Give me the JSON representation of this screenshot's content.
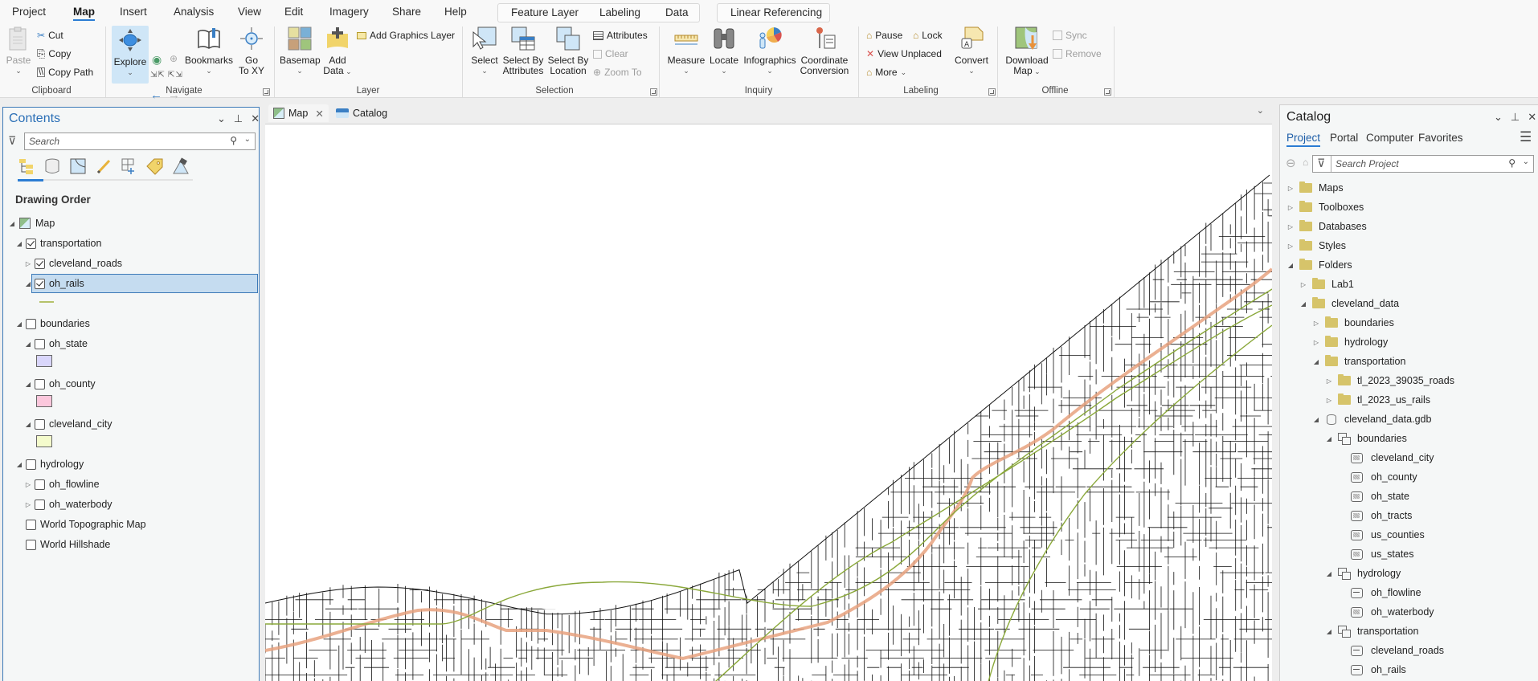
{
  "menu_tabs": [
    "Project",
    "Map",
    "Insert",
    "Analysis",
    "View",
    "Edit",
    "Imagery",
    "Share",
    "Help"
  ],
  "active_menu_tab": "Map",
  "contextual_tabs": {
    "feature_layer_group": [
      "Feature Layer",
      "Labeling",
      "Data"
    ],
    "linear_referencing": "Linear Referencing"
  },
  "ribbon": {
    "clipboard": {
      "label": "Clipboard",
      "paste": "Paste",
      "cut": "Cut",
      "copy": "Copy",
      "copy_path": "Copy Path"
    },
    "navigate": {
      "label": "Navigate",
      "explore": "Explore",
      "bookmarks": "Bookmarks",
      "go_to_xy_1": "Go",
      "go_to_xy_2": "To XY"
    },
    "layer": {
      "label": "Layer",
      "basemap": "Basemap",
      "add_data_1": "Add",
      "add_data_2": "Data",
      "add_graphics_layer": "Add Graphics Layer"
    },
    "selection": {
      "label": "Selection",
      "select": "Select",
      "select_by_attributes_1": "Select By",
      "select_by_attributes_2": "Attributes",
      "select_by_location_1": "Select By",
      "select_by_location_2": "Location",
      "attributes": "Attributes",
      "clear": "Clear",
      "zoom_to": "Zoom To"
    },
    "inquiry": {
      "label": "Inquiry",
      "measure": "Measure",
      "locate": "Locate",
      "infographics": "Infographics",
      "coordinate_conversion_1": "Coordinate",
      "coordinate_conversion_2": "Conversion"
    },
    "labeling": {
      "label": "Labeling",
      "pause": "Pause",
      "lock": "Lock",
      "view_unplaced": "View Unplaced",
      "more": "More",
      "convert": "Convert"
    },
    "offline": {
      "label": "Offline",
      "download_map_1": "Download",
      "download_map_2": "Map",
      "sync": "Sync",
      "remove": "Remove"
    }
  },
  "contents": {
    "title": "Contents",
    "search_placeholder": "Search",
    "section_title": "Drawing Order",
    "map_name": "Map",
    "layers": [
      {
        "name": "transportation",
        "checked": true,
        "expanded": true,
        "level": 1
      },
      {
        "name": "cleveland_roads",
        "checked": true,
        "expanded": false,
        "level": 2
      },
      {
        "name": "oh_rails",
        "checked": true,
        "expanded": true,
        "level": 2,
        "selected": true,
        "symbol_color": "#b5c26a"
      },
      {
        "name": "boundaries",
        "checked": false,
        "expanded": true,
        "level": 1
      },
      {
        "name": "oh_state",
        "checked": false,
        "expanded": true,
        "level": 2,
        "symbol_color": "#d9d6fb"
      },
      {
        "name": "oh_county",
        "checked": false,
        "expanded": true,
        "level": 2,
        "symbol_color": "#fbc7dc"
      },
      {
        "name": "cleveland_city",
        "checked": false,
        "expanded": true,
        "level": 2,
        "symbol_color": "#f4fbcc"
      },
      {
        "name": "hydrology",
        "checked": false,
        "expanded": true,
        "level": 1
      },
      {
        "name": "oh_flowline",
        "checked": false,
        "expanded": false,
        "level": 2
      },
      {
        "name": "oh_waterbody",
        "checked": false,
        "expanded": false,
        "level": 2
      },
      {
        "name": "World Topographic Map",
        "checked": false,
        "level": 1
      },
      {
        "name": "World Hillshade",
        "checked": false,
        "level": 1
      }
    ]
  },
  "doc_tabs": [
    {
      "label": "Map",
      "active": true,
      "closable": true
    },
    {
      "label": "Catalog",
      "active": false
    }
  ],
  "catalog": {
    "title": "Catalog",
    "tabs": [
      "Project",
      "Portal",
      "Computer",
      "Favorites"
    ],
    "active_tab": "Project",
    "search_placeholder": "Search Project",
    "items": [
      {
        "name": "Maps",
        "type": "project-folder",
        "level": 0,
        "expanded": false
      },
      {
        "name": "Toolboxes",
        "type": "project-folder",
        "level": 0,
        "expanded": false
      },
      {
        "name": "Databases",
        "type": "project-folder",
        "level": 0,
        "expanded": false
      },
      {
        "name": "Styles",
        "type": "project-folder",
        "level": 0,
        "expanded": false
      },
      {
        "name": "Folders",
        "type": "project-folder",
        "level": 0,
        "expanded": true
      },
      {
        "name": "Lab1",
        "type": "home-folder",
        "level": 1,
        "expanded": false
      },
      {
        "name": "cleveland_data",
        "type": "folder",
        "level": 1,
        "expanded": true
      },
      {
        "name": "boundaries",
        "type": "folder",
        "level": 2,
        "expanded": false
      },
      {
        "name": "hydrology",
        "type": "folder",
        "level": 2,
        "expanded": false
      },
      {
        "name": "transportation",
        "type": "folder",
        "level": 2,
        "expanded": true
      },
      {
        "name": "tl_2023_39035_roads",
        "type": "folder",
        "level": 3,
        "expanded": false
      },
      {
        "name": "tl_2023_us_rails",
        "type": "folder",
        "level": 3,
        "expanded": false
      },
      {
        "name": "cleveland_data.gdb",
        "type": "gdb",
        "level": 2,
        "expanded": true
      },
      {
        "name": "boundaries",
        "type": "dataset",
        "level": 3,
        "expanded": true
      },
      {
        "name": "cleveland_city",
        "type": "polygon",
        "level": 4
      },
      {
        "name": "oh_county",
        "type": "polygon",
        "level": 4
      },
      {
        "name": "oh_state",
        "type": "polygon",
        "level": 4
      },
      {
        "name": "oh_tracts",
        "type": "polygon",
        "level": 4
      },
      {
        "name": "us_counties",
        "type": "polygon",
        "level": 4
      },
      {
        "name": "us_states",
        "type": "polygon",
        "level": 4
      },
      {
        "name": "hydrology",
        "type": "dataset",
        "level": 3,
        "expanded": true
      },
      {
        "name": "oh_flowline",
        "type": "line",
        "level": 4
      },
      {
        "name": "oh_waterbody",
        "type": "polygon",
        "level": 4
      },
      {
        "name": "transportation",
        "type": "dataset",
        "level": 3,
        "expanded": true
      },
      {
        "name": "cleveland_roads",
        "type": "line",
        "level": 4
      },
      {
        "name": "oh_rails",
        "type": "line",
        "level": 4
      }
    ]
  },
  "colors": {
    "accent": "#2b7cd3",
    "selection_fill": "#c5dcf0",
    "highway": "#e8a27f",
    "rails": "#8aa83a",
    "roads": "#111111"
  }
}
